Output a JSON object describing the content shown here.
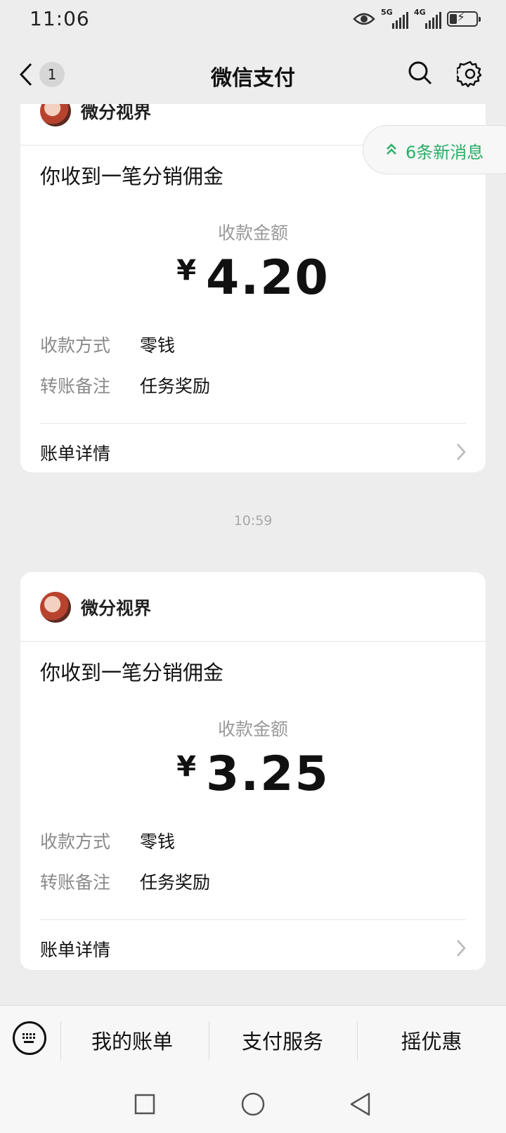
{
  "status_bar": {
    "time": "11:06",
    "network_1": "5G",
    "network_2": "4G"
  },
  "nav": {
    "title": "微信支付",
    "unread_count": "1"
  },
  "new_messages": {
    "label": "6条新消息"
  },
  "messages": [
    {
      "sender": "微分视界",
      "title": "你收到一笔分销佣金",
      "amount_label": "收款金额",
      "currency": "¥",
      "amount": "4.20",
      "method_label": "收款方式",
      "method_value": "零钱",
      "remark_label": "转账备注",
      "remark_value": "任务奖励",
      "detail_label": "账单详情"
    },
    {
      "timestamp": "10:59",
      "sender": "微分视界",
      "title": "你收到一笔分销佣金",
      "amount_label": "收款金额",
      "currency": "¥",
      "amount": "3.25",
      "method_label": "收款方式",
      "method_value": "零钱",
      "remark_label": "转账备注",
      "remark_value": "任务奖励",
      "detail_label": "账单详情"
    }
  ],
  "bottom_menu": {
    "items": [
      "我的账单",
      "支付服务",
      "摇优惠"
    ]
  },
  "colors": {
    "accent_green": "#2aae67",
    "background": "#ededed",
    "card": "#ffffff"
  }
}
